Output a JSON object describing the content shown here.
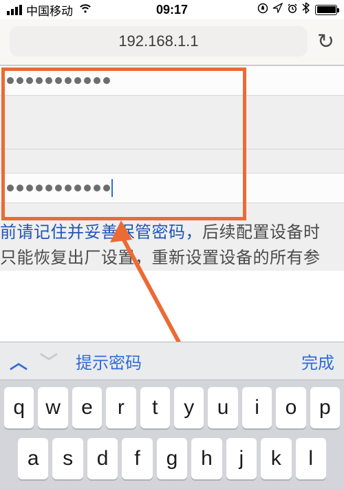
{
  "status": {
    "carrier": "中国移动",
    "time": "09:17",
    "icons": {
      "lock": "⊕",
      "loc": "➤",
      "alarm": "⏰",
      "bt": "✱"
    }
  },
  "urlbar": {
    "url": "192.168.1.1"
  },
  "form": {
    "password1_len": 11,
    "password2_len": 11
  },
  "hint": {
    "line1_strong": "前请记住并妥善保管密码，",
    "line1_rest": "后续配置设备时",
    "line2": "只能恢复出厂设置，重新设置设备的所有参"
  },
  "accessory": {
    "suggest": "提示密码",
    "done": "完成"
  },
  "keyboard": {
    "row1": [
      "q",
      "w",
      "e",
      "r",
      "t",
      "y",
      "u",
      "i",
      "o",
      "p"
    ],
    "row2": [
      "a",
      "s",
      "d",
      "f",
      "g",
      "h",
      "j",
      "k",
      "l"
    ]
  }
}
